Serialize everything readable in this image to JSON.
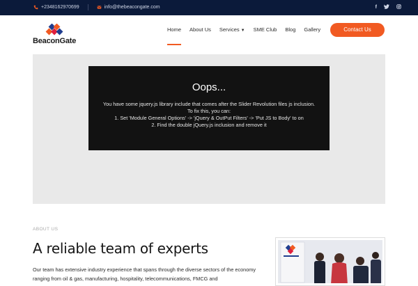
{
  "topbar": {
    "phone": "+2348162970699",
    "email": "info@thebeacongate.com",
    "social": [
      "facebook-icon",
      "twitter-icon",
      "instagram-icon"
    ]
  },
  "logo": {
    "text": "BeaconGate"
  },
  "nav": {
    "items": [
      "Home",
      "About Us",
      "Services",
      "SME Club",
      "Blog",
      "Gallery"
    ],
    "active": "Home",
    "contact_button": "Contact Us"
  },
  "hero": {
    "error_title": "Oops...",
    "error_lines": [
      "You have some jquery.js library include that comes after the Slider Revolution files js inclusion.",
      "To fix this, you can:",
      "1. Set 'Module General Options' -> 'jQuery & OutPut Filters' -> 'Put JS to Body' to on",
      "2. Find the double jQuery.js inclusion and remove it"
    ]
  },
  "about": {
    "label": "ABOUT US",
    "title": "A reliable team of experts",
    "body": "Our team has extensive industry experience that spans through the diverse sectors of the economy ranging from oil & gas, manufacturing, hospitality, telecommunications, FMCG and"
  },
  "colors": {
    "topbar_bg": "#0b1a3a",
    "accent": "#f15a22",
    "hero_bg": "#e9e9e9",
    "error_box": "#121212"
  }
}
